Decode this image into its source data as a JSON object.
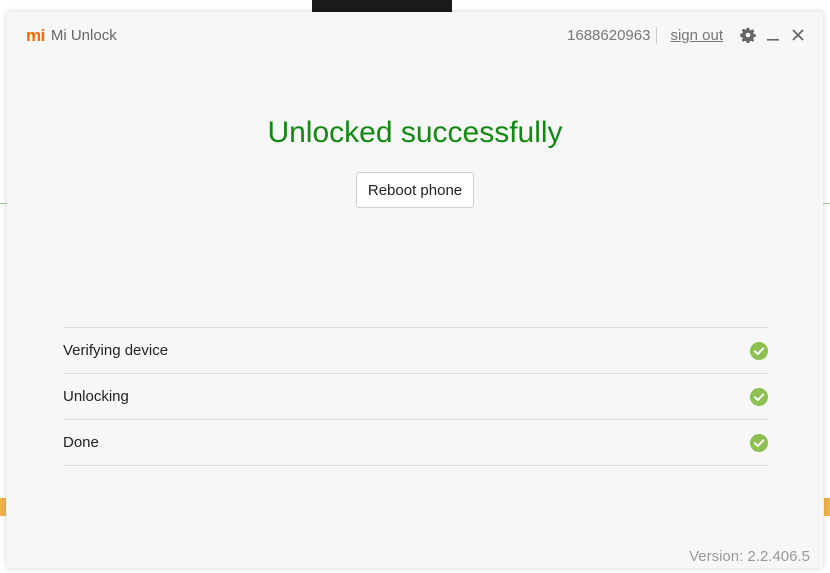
{
  "app": {
    "logo_mark": "mi",
    "title": "Mi Unlock",
    "account_id": "1688620963",
    "sign_out": "sign out",
    "icons": {
      "settings": "gear-icon",
      "minimize": "minimize-icon",
      "close": "close-icon"
    }
  },
  "main": {
    "headline": "Unlocked successfully",
    "reboot_button": "Reboot phone"
  },
  "steps": [
    {
      "label": "Verifying device",
      "status": "done"
    },
    {
      "label": "Unlocking",
      "status": "done"
    },
    {
      "label": "Done",
      "status": "done"
    }
  ],
  "footer": {
    "version": "Version: 2.2.406.5"
  },
  "colors": {
    "brand": "#ff6700",
    "success_text": "#128a12",
    "check": "#8cc152"
  }
}
